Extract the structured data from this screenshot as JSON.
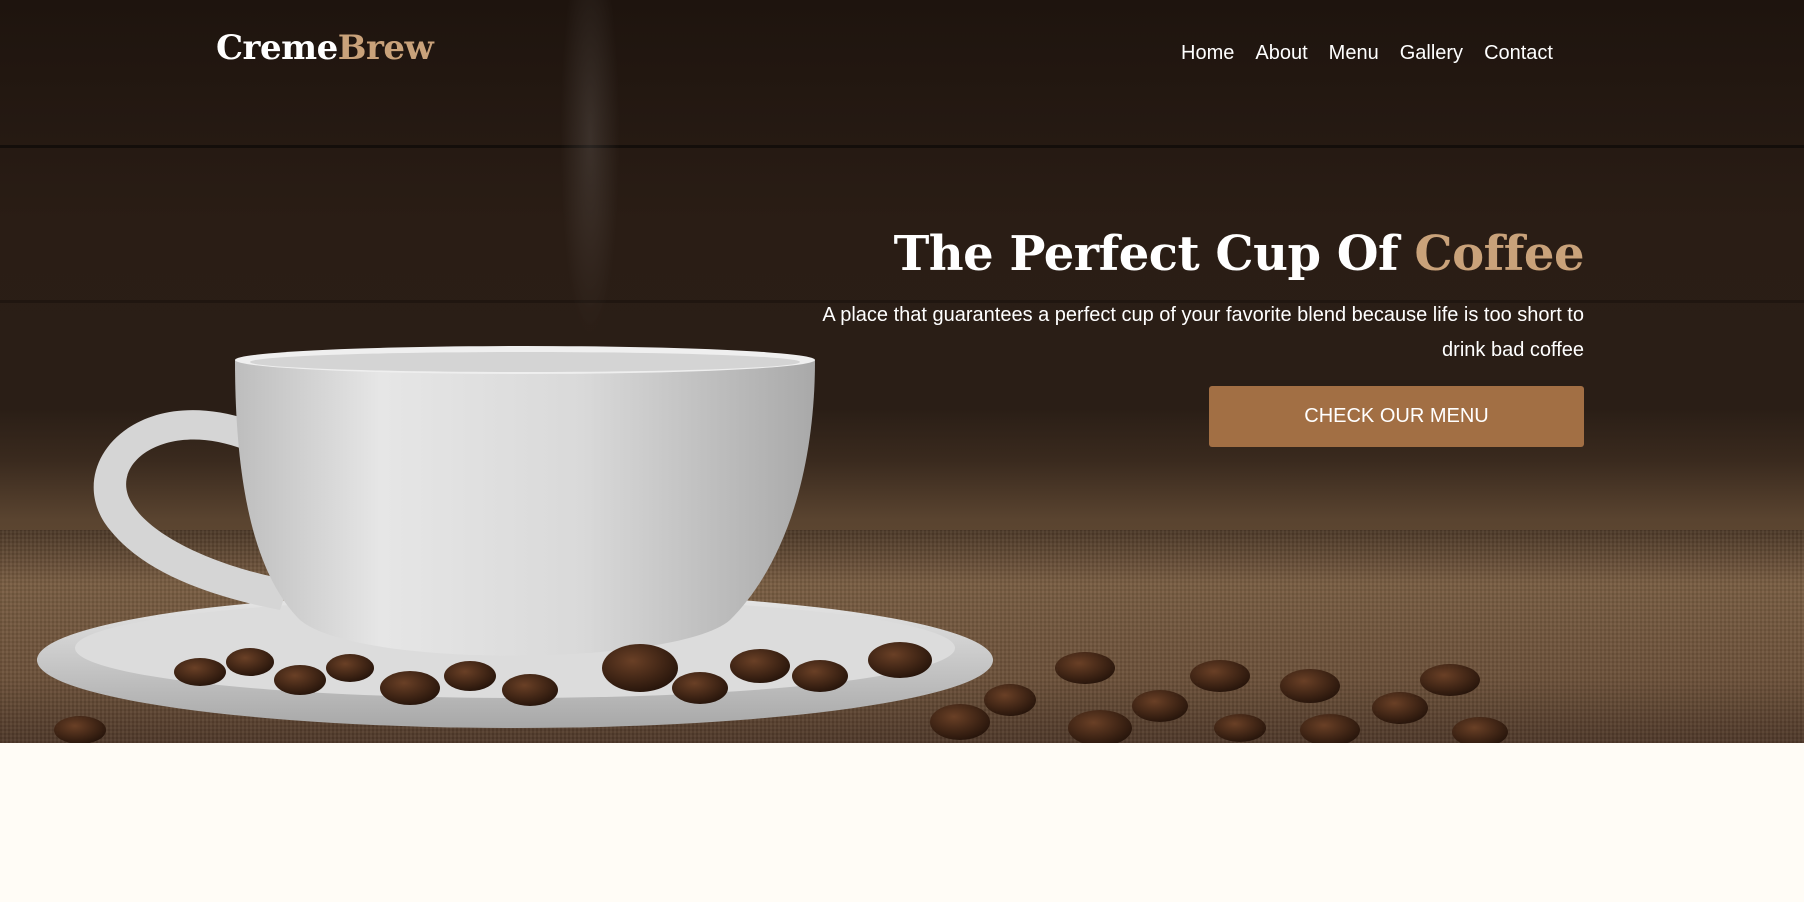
{
  "brand": {
    "name_part1": "Creme",
    "name_part2": "Brew",
    "accent_color": "#c9a27a"
  },
  "nav": {
    "items": [
      {
        "label": "Home"
      },
      {
        "label": "About"
      },
      {
        "label": "Menu"
      },
      {
        "label": "Gallery"
      },
      {
        "label": "Contact"
      }
    ]
  },
  "hero": {
    "headline_main": "The Perfect Cup Of ",
    "headline_accent": "Coffee",
    "subtext": "A place that guarantees a perfect cup of your favorite blend because life is too short to drink bad coffee",
    "cta_label": "CHECK OUR MENU",
    "cta_color": "#a26f44"
  },
  "colors": {
    "page_background": "#fffcf6",
    "text_light": "#ffffff"
  }
}
